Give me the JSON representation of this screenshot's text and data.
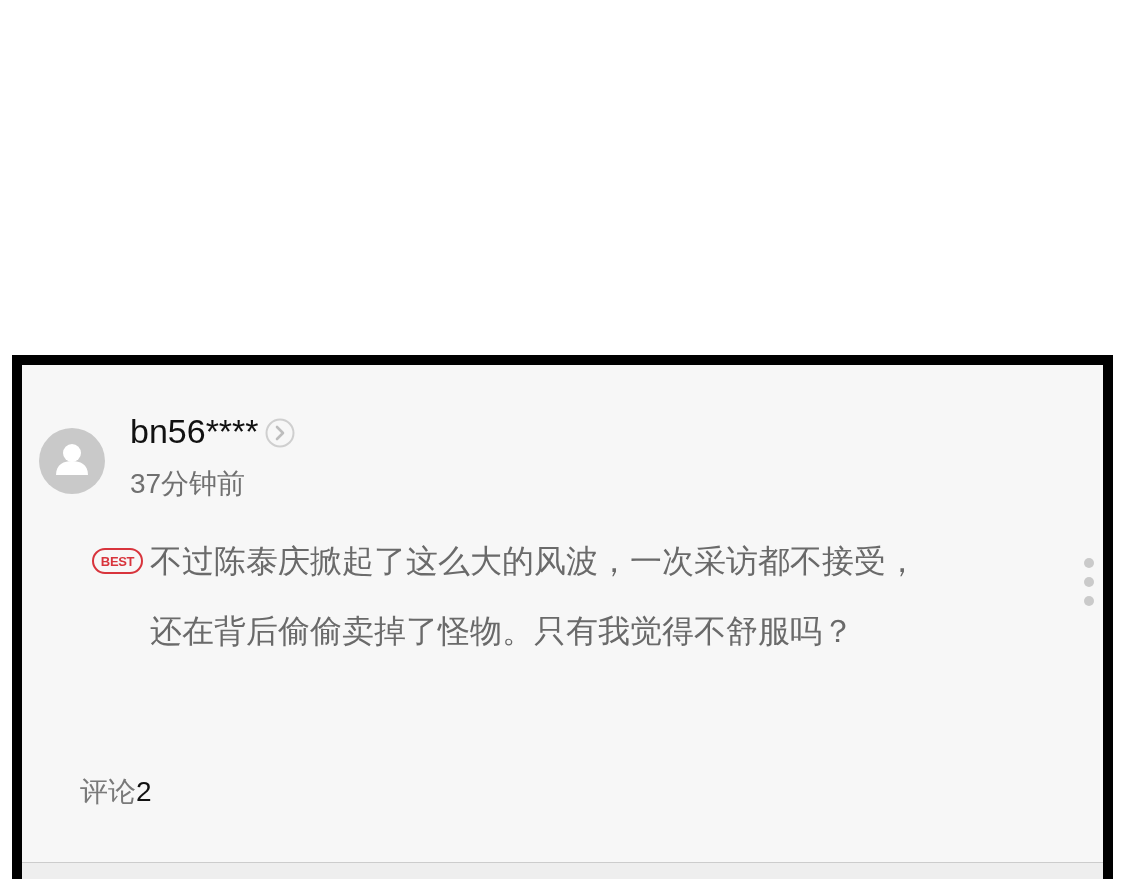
{
  "comment": {
    "author": {
      "name": "bn56****",
      "time": "37分钟前"
    },
    "badge": "BEST",
    "lines": [
      "不过陈泰庆掀起了这么大的风波，一次采访都不接受，",
      "还在背后偷偷卖掉了怪物。只有我觉得不舒服吗？"
    ],
    "replies": {
      "label": "评论",
      "count": "2"
    }
  }
}
